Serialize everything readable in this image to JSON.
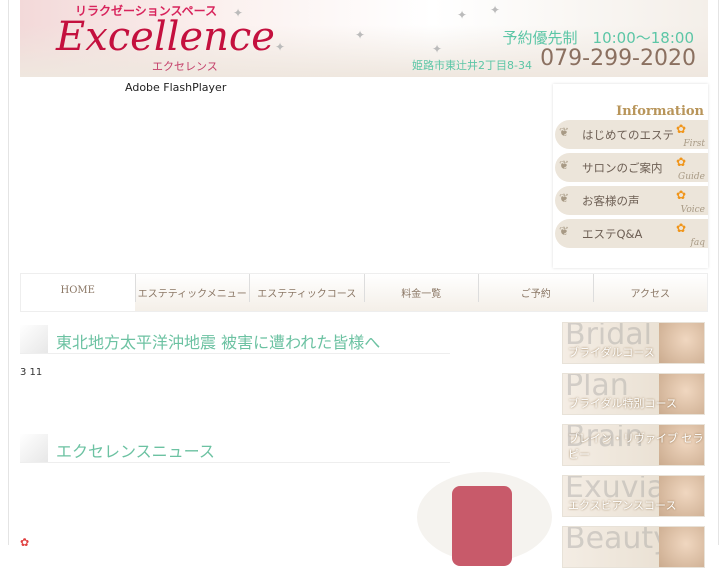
{
  "header": {
    "subtitle": "リラクゼーションスペース",
    "logo": "Excellence",
    "logo_kana": "エクセレンス",
    "hours": "予約優先制　10:00〜18:00",
    "address": "姫路市東辻井2丁目8-34",
    "phone": "079-299-2020"
  },
  "flash": {
    "label": "Adobe FlashPlayer"
  },
  "info": {
    "title": "Information",
    "items": [
      {
        "label": "はじめてのエステ",
        "en": "First"
      },
      {
        "label": "サロンのご案内",
        "en": "Guide"
      },
      {
        "label": "お客様の声",
        "en": "Voice"
      },
      {
        "label": "エステQ&A",
        "en": "faq"
      }
    ]
  },
  "nav": [
    "HOME",
    "エステティックメニュー",
    "エステティックコース",
    "料金一覧",
    "ご予約",
    "アクセス"
  ],
  "main": {
    "heading1": "東北地方太平洋沖地震 被害に遭われた皆様へ",
    "date": "3 11",
    "heading2": "エクセレンスニュース"
  },
  "banners": [
    {
      "big": "Bridal",
      "label": "ブライダルコース"
    },
    {
      "big": "Plan",
      "label": "ブライダル特別コース"
    },
    {
      "big": "Brain",
      "label": "ブレイン・リヴァイブ セラピー"
    },
    {
      "big": "Exuviance",
      "label": "エクスビアンスコース"
    },
    {
      "big": "Beauty",
      "label": ""
    }
  ]
}
